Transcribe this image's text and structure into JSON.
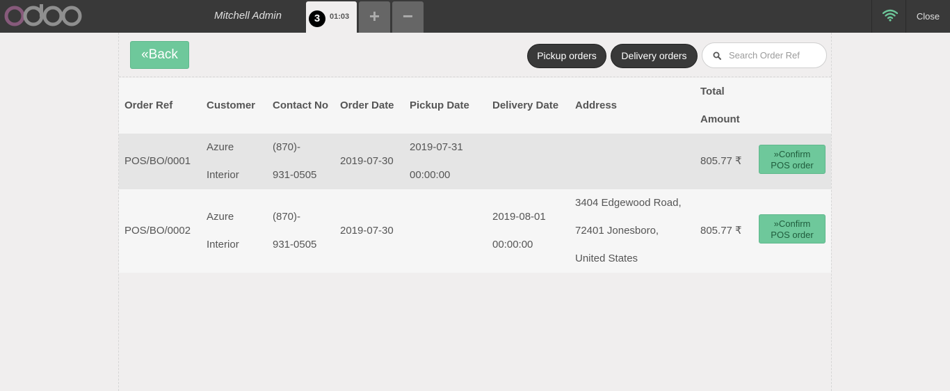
{
  "topbar": {
    "cashier": "Mitchell Admin",
    "order_number": "3",
    "order_time": "01:03",
    "add_label": "+",
    "remove_label": "−",
    "close_label": "Close"
  },
  "toolbar": {
    "back_label": "Back",
    "pickup_label": "Pickup orders",
    "delivery_label": "Delivery orders",
    "search_placeholder": "Search Order Ref"
  },
  "table": {
    "headers": {
      "order_ref": "Order Ref",
      "customer": "Customer",
      "contact": "Contact No",
      "order_date": "Order Date",
      "pickup_date": "Pickup Date",
      "delivery_date": "Delivery Date",
      "address": "Address",
      "total_line1": "Total",
      "total_line2": "Amount"
    },
    "rows": [
      {
        "order_ref": "POS/BO/0001",
        "customer_l1": "Azure",
        "customer_l2": "Interior",
        "contact_l1": "(870)-",
        "contact_l2": "931-0505",
        "order_date": "2019-07-30",
        "pickup_date_l1": "2019-07-31",
        "pickup_date_l2": "00:00:00",
        "delivery_date_l1": "",
        "delivery_date_l2": "",
        "address_l1": "",
        "address_l2": "",
        "address_l3": "",
        "total": "805.77 ₹",
        "confirm_l1": "Confirm",
        "confirm_l2": "POS order"
      },
      {
        "order_ref": "POS/BO/0002",
        "customer_l1": "Azure",
        "customer_l2": "Interior",
        "contact_l1": "(870)-",
        "contact_l2": "931-0505",
        "order_date": "2019-07-30",
        "pickup_date_l1": "",
        "pickup_date_l2": "",
        "delivery_date_l1": "2019-08-01",
        "delivery_date_l2": "00:00:00",
        "address_l1": "3404 Edgewood Road,",
        "address_l2": "72401 Jonesboro,",
        "address_l3": "United States",
        "total": "805.77 ₹",
        "confirm_l1": "Confirm",
        "confirm_l2": "POS order"
      }
    ]
  },
  "colors": {
    "topbar": "#393939",
    "accent_green": "#6ec89b",
    "logo_purple": "#875a7b",
    "logo_grey": "#8f8f8f",
    "wifi_green": "#6ec89b"
  },
  "icons": {
    "logo": "odoo-logo",
    "wifi": "wifi-icon",
    "search": "search-icon",
    "back": "double-chevron-left-icon",
    "confirm": "double-chevron-right-icon"
  }
}
